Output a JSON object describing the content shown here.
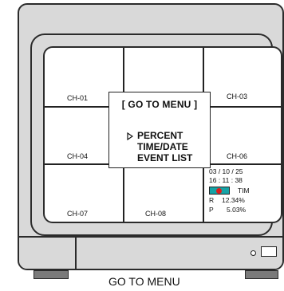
{
  "channels": [
    "CH-01",
    "CH-03",
    "CH-04",
    "CH-06",
    "CH-07",
    "CH-08"
  ],
  "menu": {
    "title": "[ GO TO MENU ]",
    "items": [
      "PERCENT",
      "TIME/DATE",
      "EVENT LIST"
    ],
    "selected": "PERCENT"
  },
  "status": {
    "date": "03 / 10 / 25",
    "time": "16 : 11 : 38",
    "mode": "TIM",
    "r_label": "R",
    "r_value": "12.34%",
    "p_label": "P",
    "p_value": "5.03%"
  },
  "caption": "GO TO MENU",
  "colors": {
    "body": "#d9d9d9",
    "outline": "#2b2b2b",
    "screen": "#ffffff",
    "rec_block": "#16a3a6",
    "rec_dot": "#e11c1c",
    "feet": "#7a7a7a"
  },
  "icons": [
    "cursor-triangle-icon",
    "record-indicator-icon",
    "power-led-icon",
    "disk-slot-icon"
  ]
}
